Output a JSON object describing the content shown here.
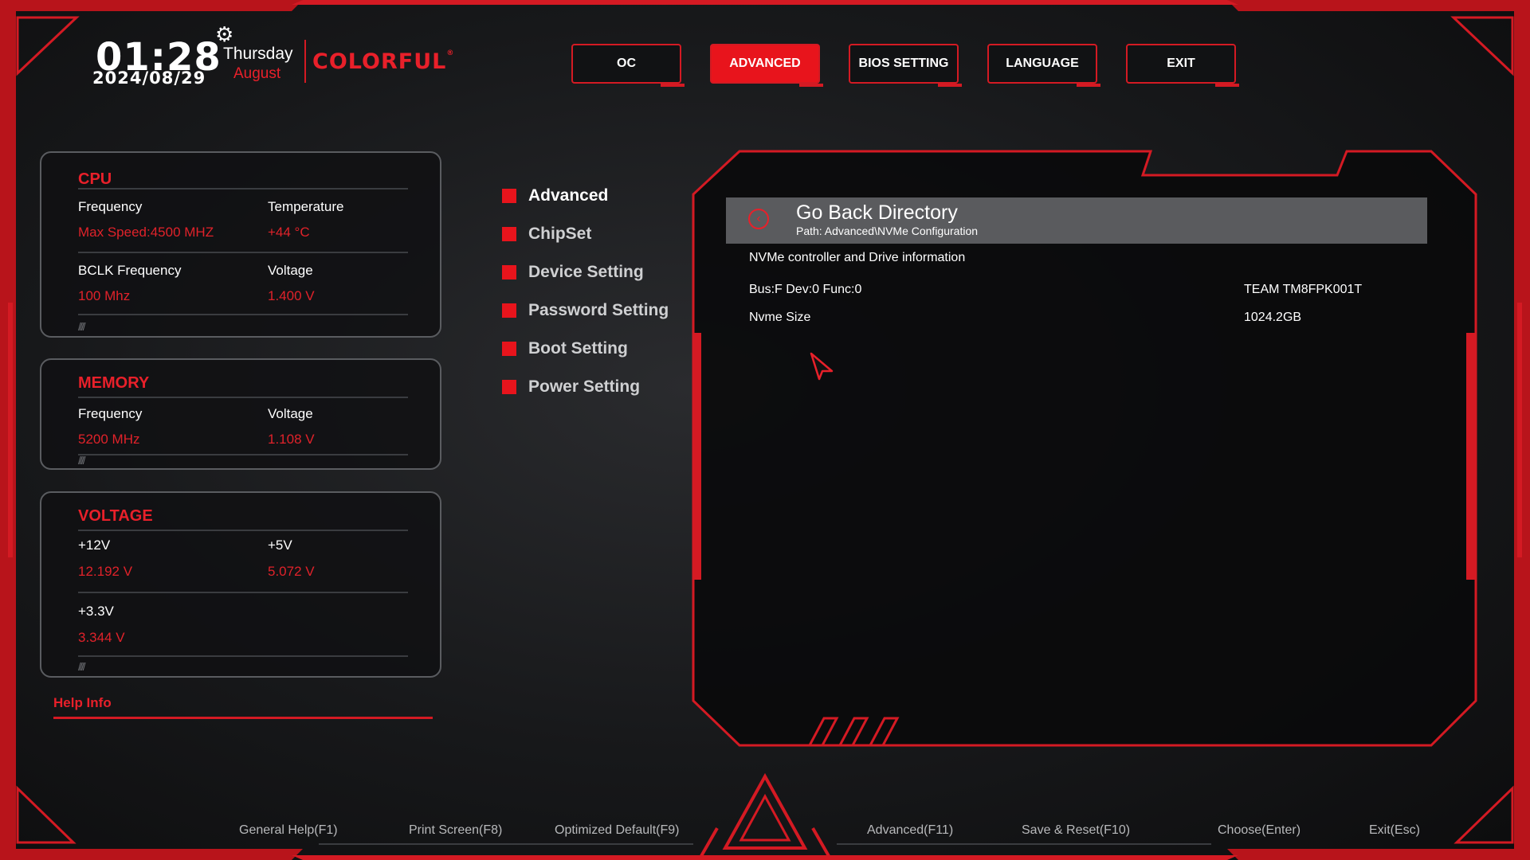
{
  "clock": {
    "time": "01:28",
    "date": "2024/08/29",
    "day": "Thursday",
    "month": "August"
  },
  "brand": {
    "name": "COLORFUL",
    "mark": "®"
  },
  "nav": [
    {
      "label": "OC",
      "active": false
    },
    {
      "label": "ADVANCED",
      "active": true
    },
    {
      "label": "BIOS SETTING",
      "active": false
    },
    {
      "label": "LANGUAGE",
      "active": false
    },
    {
      "label": "EXIT",
      "active": false
    }
  ],
  "cpu": {
    "title": "CPU",
    "frequency_label": "Frequency",
    "frequency_value": "Max Speed:4500 MHZ",
    "temperature_label": "Temperature",
    "temperature_value": "+44 °C",
    "bclk_label": "BCLK Frequency",
    "bclk_value": "100 Mhz",
    "voltage_label": "Voltage",
    "voltage_value": "1.400 V"
  },
  "memory": {
    "title": "MEMORY",
    "frequency_label": "Frequency",
    "frequency_value": "5200 MHz",
    "voltage_label": "Voltage",
    "voltage_value": "1.108 V"
  },
  "voltage": {
    "title": "VOLTAGE",
    "v12_label": "+12V",
    "v12_value": "12.192 V",
    "v5_label": "+5V",
    "v5_value": "5.072 V",
    "v33_label": "+3.3V",
    "v33_value": "3.344 V"
  },
  "help": {
    "label": "Help Info"
  },
  "menu": [
    {
      "label": "Advanced"
    },
    {
      "label": "ChipSet"
    },
    {
      "label": "Device Setting"
    },
    {
      "label": "Password Setting"
    },
    {
      "label": "Boot Setting"
    },
    {
      "label": "Power Setting"
    }
  ],
  "content": {
    "goback_title": "Go Back Directory",
    "goback_path": "Path: Advanced\\NVMe Configuration",
    "heading": "NVMe controller and Drive information",
    "rows": [
      {
        "label": "Bus:F Dev:0 Func:0",
        "value": "TEAM TM8FPK001T"
      },
      {
        "label": "Nvme Size",
        "value": "1024.2GB"
      }
    ]
  },
  "footer": [
    "General Help(F1)",
    "Print Screen(F8)",
    "Optimized Default(F9)",
    "Advanced(F11)",
    "Save & Reset(F10)",
    "Choose(Enter)",
    "Exit(Esc)"
  ],
  "colors": {
    "accent": "#e8141c",
    "panel_border": "#5a5c60",
    "background": "#17181a"
  }
}
